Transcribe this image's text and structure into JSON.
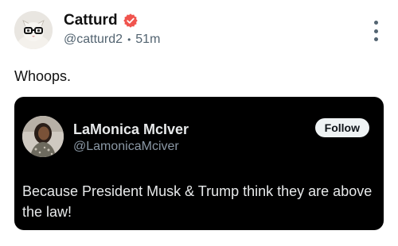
{
  "post": {
    "author": {
      "name": "Catturd",
      "handle": "@catturd2",
      "verified": true,
      "avatar_icon": "cat-with-glasses-avatar"
    },
    "separator": "•",
    "timestamp": "51m",
    "menu_icon": "more-vertical-icon",
    "text": "Whoops."
  },
  "embedded_post": {
    "author": {
      "name": "LaMonica McIver",
      "handle": "@LamonicaMciver",
      "avatar_icon": "person-photo-avatar"
    },
    "follow_label": "Follow",
    "text": "Because President Musk & Trump think they are above the law!"
  },
  "colors": {
    "verified_badge": "#f0544e",
    "embed_background": "#000000",
    "secondary_text": "#536471"
  }
}
